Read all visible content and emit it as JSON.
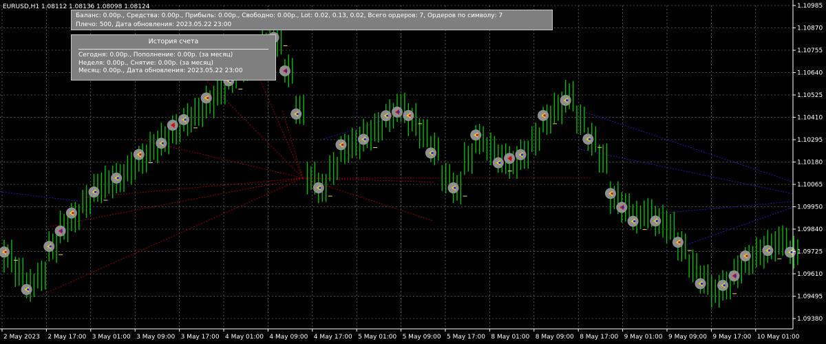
{
  "header": {
    "symbol_label": "EURUSD,H1  1.08112 1.08136 1.08098 1.08124"
  },
  "account": {
    "line1": "Баланс: 0.00р., Средства: 0.00р., Прибыль: 0.00р., Свободно: 0.00р., Lot: 0.02, 0.13, 0.02, Всего ордеров: 7, Ордеров по символу: 7",
    "line2": "Плечо: 500, Дата обновления: 2023.05.22 23:00"
  },
  "history": {
    "title": "История счета",
    "today": "Сегодня: 0.00р., Пополнение: 0.00р. (за месяц)",
    "week": "Неделя: 0.00р., Снятие: 0.00р. (за месяц)",
    "month": "Месяц: 0.00р., Дата обновления: 2023.05.22 23:00"
  },
  "colors": {
    "background": "#000000",
    "candle": "#00c000",
    "grid": "#8a8a8a",
    "text": "#ffffff",
    "marker": "#8f8f8f",
    "dotted_red": "#c00000",
    "dotted_blue": "#1c1cd2"
  },
  "chart_data": {
    "type": "candlestick",
    "price_ticks": [
      "1.10985",
      "1.10870",
      "1.10755",
      "1.10640",
      "1.10525",
      "1.10410",
      "1.10295",
      "1.10180",
      "1.10065",
      "1.09950",
      "1.09840",
      "1.09725",
      "1.09610",
      "1.09495",
      "1.09380"
    ],
    "time_ticks": [
      "2 May 2023",
      "2 May 17:00",
      "3 May 01:00",
      "3 May 09:00",
      "3 May 17:00",
      "4 May 01:00",
      "4 May 09:00",
      "4 May 17:00",
      "5 May 01:00",
      "5 May 09:00",
      "5 May 17:00",
      "8 May 01:00",
      "8 May 09:00",
      "8 May 17:00",
      "9 May 01:00",
      "9 May 09:00",
      "9 May 17:00",
      "10 May 01:00"
    ],
    "ylim": [
      1.0938,
      1.10985
    ],
    "price_line": [
      1.097,
      1.0962,
      1.0955,
      1.096,
      1.0975,
      1.0985,
      1.099,
      1.0998,
      1.1005,
      1.1008,
      1.101,
      1.1015,
      1.102,
      1.1026,
      1.103,
      1.1035,
      1.104,
      1.1044,
      1.1049,
      1.1055,
      1.1062,
      1.1067,
      1.1072,
      1.1078,
      1.108,
      1.1065,
      1.1045,
      1.101,
      1.1005,
      1.1015,
      1.1025,
      1.1028,
      1.1032,
      1.1036,
      1.1042,
      1.1046,
      1.104,
      1.1033,
      1.1025,
      1.101,
      1.1005,
      1.102,
      1.103,
      1.1025,
      1.102,
      1.1018,
      1.1022,
      1.103,
      1.104,
      1.1046,
      1.1052,
      1.104,
      1.103,
      1.102,
      1.1,
      1.0995,
      1.099,
      1.0992,
      1.0988,
      1.0985,
      1.0975,
      1.0965,
      1.0958,
      1.0952,
      1.0955,
      1.0962,
      1.0968,
      1.0972,
      1.0975,
      1.0978,
      1.0972
    ]
  }
}
